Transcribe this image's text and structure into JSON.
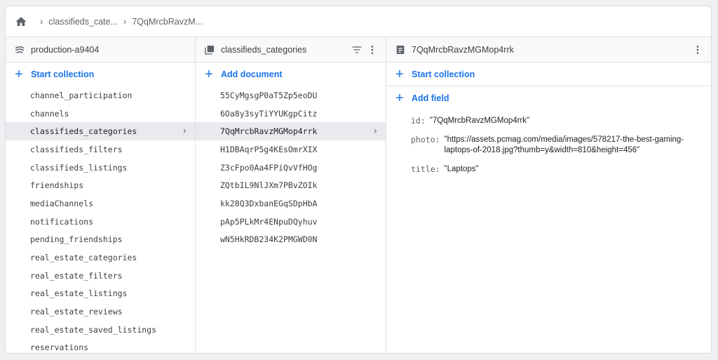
{
  "breadcrumb": {
    "items": [
      "classifieds_cate...",
      "7QqMrcbRavzM..."
    ]
  },
  "columns": {
    "root": {
      "title": "production-a9404",
      "action_label": "Start collection",
      "collections": [
        "channel_participation",
        "channels",
        "classifieds_categories",
        "classifieds_filters",
        "classifieds_listings",
        "friendships",
        "mediaChannels",
        "notifications",
        "pending_friendships",
        "real_estate_categories",
        "real_estate_filters",
        "real_estate_listings",
        "real_estate_reviews",
        "real_estate_saved_listings",
        "reservations"
      ],
      "selected_index": 2
    },
    "collection": {
      "title": "classifieds_categories",
      "action_label": "Add document",
      "documents": [
        "55CyMgsgP0aT5Zp5eoDU",
        "6Oa8y3syTiYYUKgpCitz",
        "7QqMrcbRavzMGMop4rrk",
        "H1DBAqrP5g4KEsOmrXIX",
        "Z3cFpo0Aa4FPiQvVfHOg",
        "ZQtbIL9NlJXm7PBvZOIk",
        "kk28Q3DxbanEGqSDpHbA",
        "pAp5PLkMr4ENpuDQyhuv",
        "wN5HkRDB234K2PMGWD0N"
      ],
      "selected_index": 2
    },
    "document": {
      "title": "7QqMrcbRavzMGMop4rrk",
      "start_collection_label": "Start collection",
      "add_field_label": "Add field",
      "fields": [
        {
          "key": "id:",
          "value": "\"7QqMrcbRavzMGMop4rrk\""
        },
        {
          "key": "photo:",
          "value": "\"https://assets.pcmag.com/media/images/578217-the-best-gaming-laptops-of-2018.jpg?thumb=y&width=810&height=456\""
        },
        {
          "key": "title:",
          "value": "\"Laptops\""
        }
      ]
    }
  },
  "icons": {
    "home": "home-icon",
    "database": "database-icon",
    "collection": "collection-icon",
    "document": "document-icon",
    "filter": "filter-icon",
    "more": "more-vert-icon"
  },
  "colors": {
    "accent": "#1a73e8",
    "selected_row": "#e8eaed",
    "header_bg": "#f8f9fa"
  }
}
